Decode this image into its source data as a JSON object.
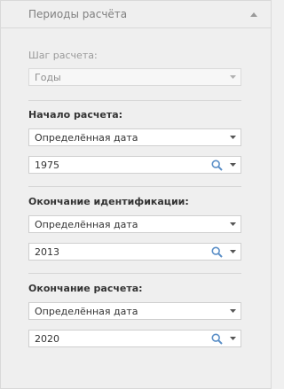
{
  "header": {
    "title": "Периоды расчёта",
    "collapse_icon": "chevron-up-icon"
  },
  "step": {
    "label": "Шаг расчета:",
    "value": "Годы",
    "disabled": true
  },
  "start": {
    "label": "Начало расчета:",
    "type_value": "Определённая дата",
    "date_value": "1975"
  },
  "identification_end": {
    "label": "Окончание идентификации:",
    "type_value": "Определённая дата",
    "date_value": "2013"
  },
  "end": {
    "label": "Окончание расчета:",
    "type_value": "Определённая дата",
    "date_value": "2020"
  },
  "colors": {
    "search_icon": "#5b8fc7",
    "arrow": "#555555",
    "disabled_text": "#9a9a9a"
  }
}
